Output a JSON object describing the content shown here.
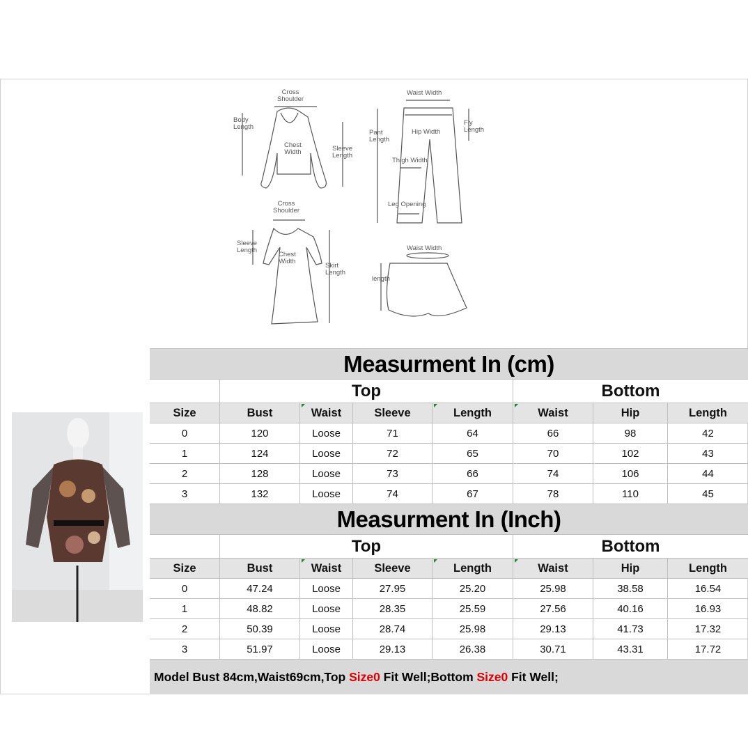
{
  "diagram": {
    "top": {
      "cross_shoulder": "Cross\nShoulder",
      "body_length": "Body\nLength",
      "chest_width": "Chest\nWidth",
      "sleeve_length": "Sleeve\nLength"
    },
    "pants": {
      "waist_width": "Waist Width",
      "pant_length": "Pant\nLength",
      "fly_length": "Fly\nLength",
      "hip_width": "Hip Width",
      "thigh_width": "Thigh Width",
      "leg_opening": "Leg Opening"
    },
    "dress": {
      "cross_shoulder": "Cross\nShoulder",
      "sleeve_length": "Sleeve\nLength",
      "chest_width": "Chest\nWidth",
      "skirt_length": "Skirt\nLength"
    },
    "skirt": {
      "waist_width": "Waist Width",
      "length": "length"
    }
  },
  "columns": {
    "size": "Size",
    "bust": "Bust",
    "waist": "Waist",
    "sleeve": "Sleeve",
    "length": "Length",
    "bwaist": "Waist",
    "hip": "Hip",
    "blength": "Length"
  },
  "groups": {
    "top": "Top",
    "bottom": "Bottom"
  },
  "cm": {
    "title": "Measurment In (cm)",
    "rows": [
      [
        "0",
        "120",
        "Loose",
        "71",
        "64",
        "66",
        "98",
        "42"
      ],
      [
        "1",
        "124",
        "Loose",
        "72",
        "65",
        "70",
        "102",
        "43"
      ],
      [
        "2",
        "128",
        "Loose",
        "73",
        "66",
        "74",
        "106",
        "44"
      ],
      [
        "3",
        "132",
        "Loose",
        "74",
        "67",
        "78",
        "110",
        "45"
      ]
    ]
  },
  "inch": {
    "title": "Measurment In (Inch)",
    "rows": [
      [
        "0",
        "47.24",
        "Loose",
        "27.95",
        "25.20",
        "25.98",
        "38.58",
        "16.54"
      ],
      [
        "1",
        "48.82",
        "Loose",
        "28.35",
        "25.59",
        "27.56",
        "40.16",
        "16.93"
      ],
      [
        "2",
        "50.39",
        "Loose",
        "28.74",
        "25.98",
        "29.13",
        "41.73",
        "17.32"
      ],
      [
        "3",
        "51.97",
        "Loose",
        "29.13",
        "26.38",
        "30.71",
        "43.31",
        "17.72"
      ]
    ]
  },
  "footer": {
    "p1": "Model Bust 84cm,Waist69cm,Top ",
    "s1": "Size0",
    "p2": " Fit Well;Bottom ",
    "s2": "Size0",
    "p3": " Fit Well;"
  },
  "colors": {
    "accent_red": "#e00000",
    "header_gray": "#d9d9d9",
    "marker_green": "#1a8a2a"
  }
}
